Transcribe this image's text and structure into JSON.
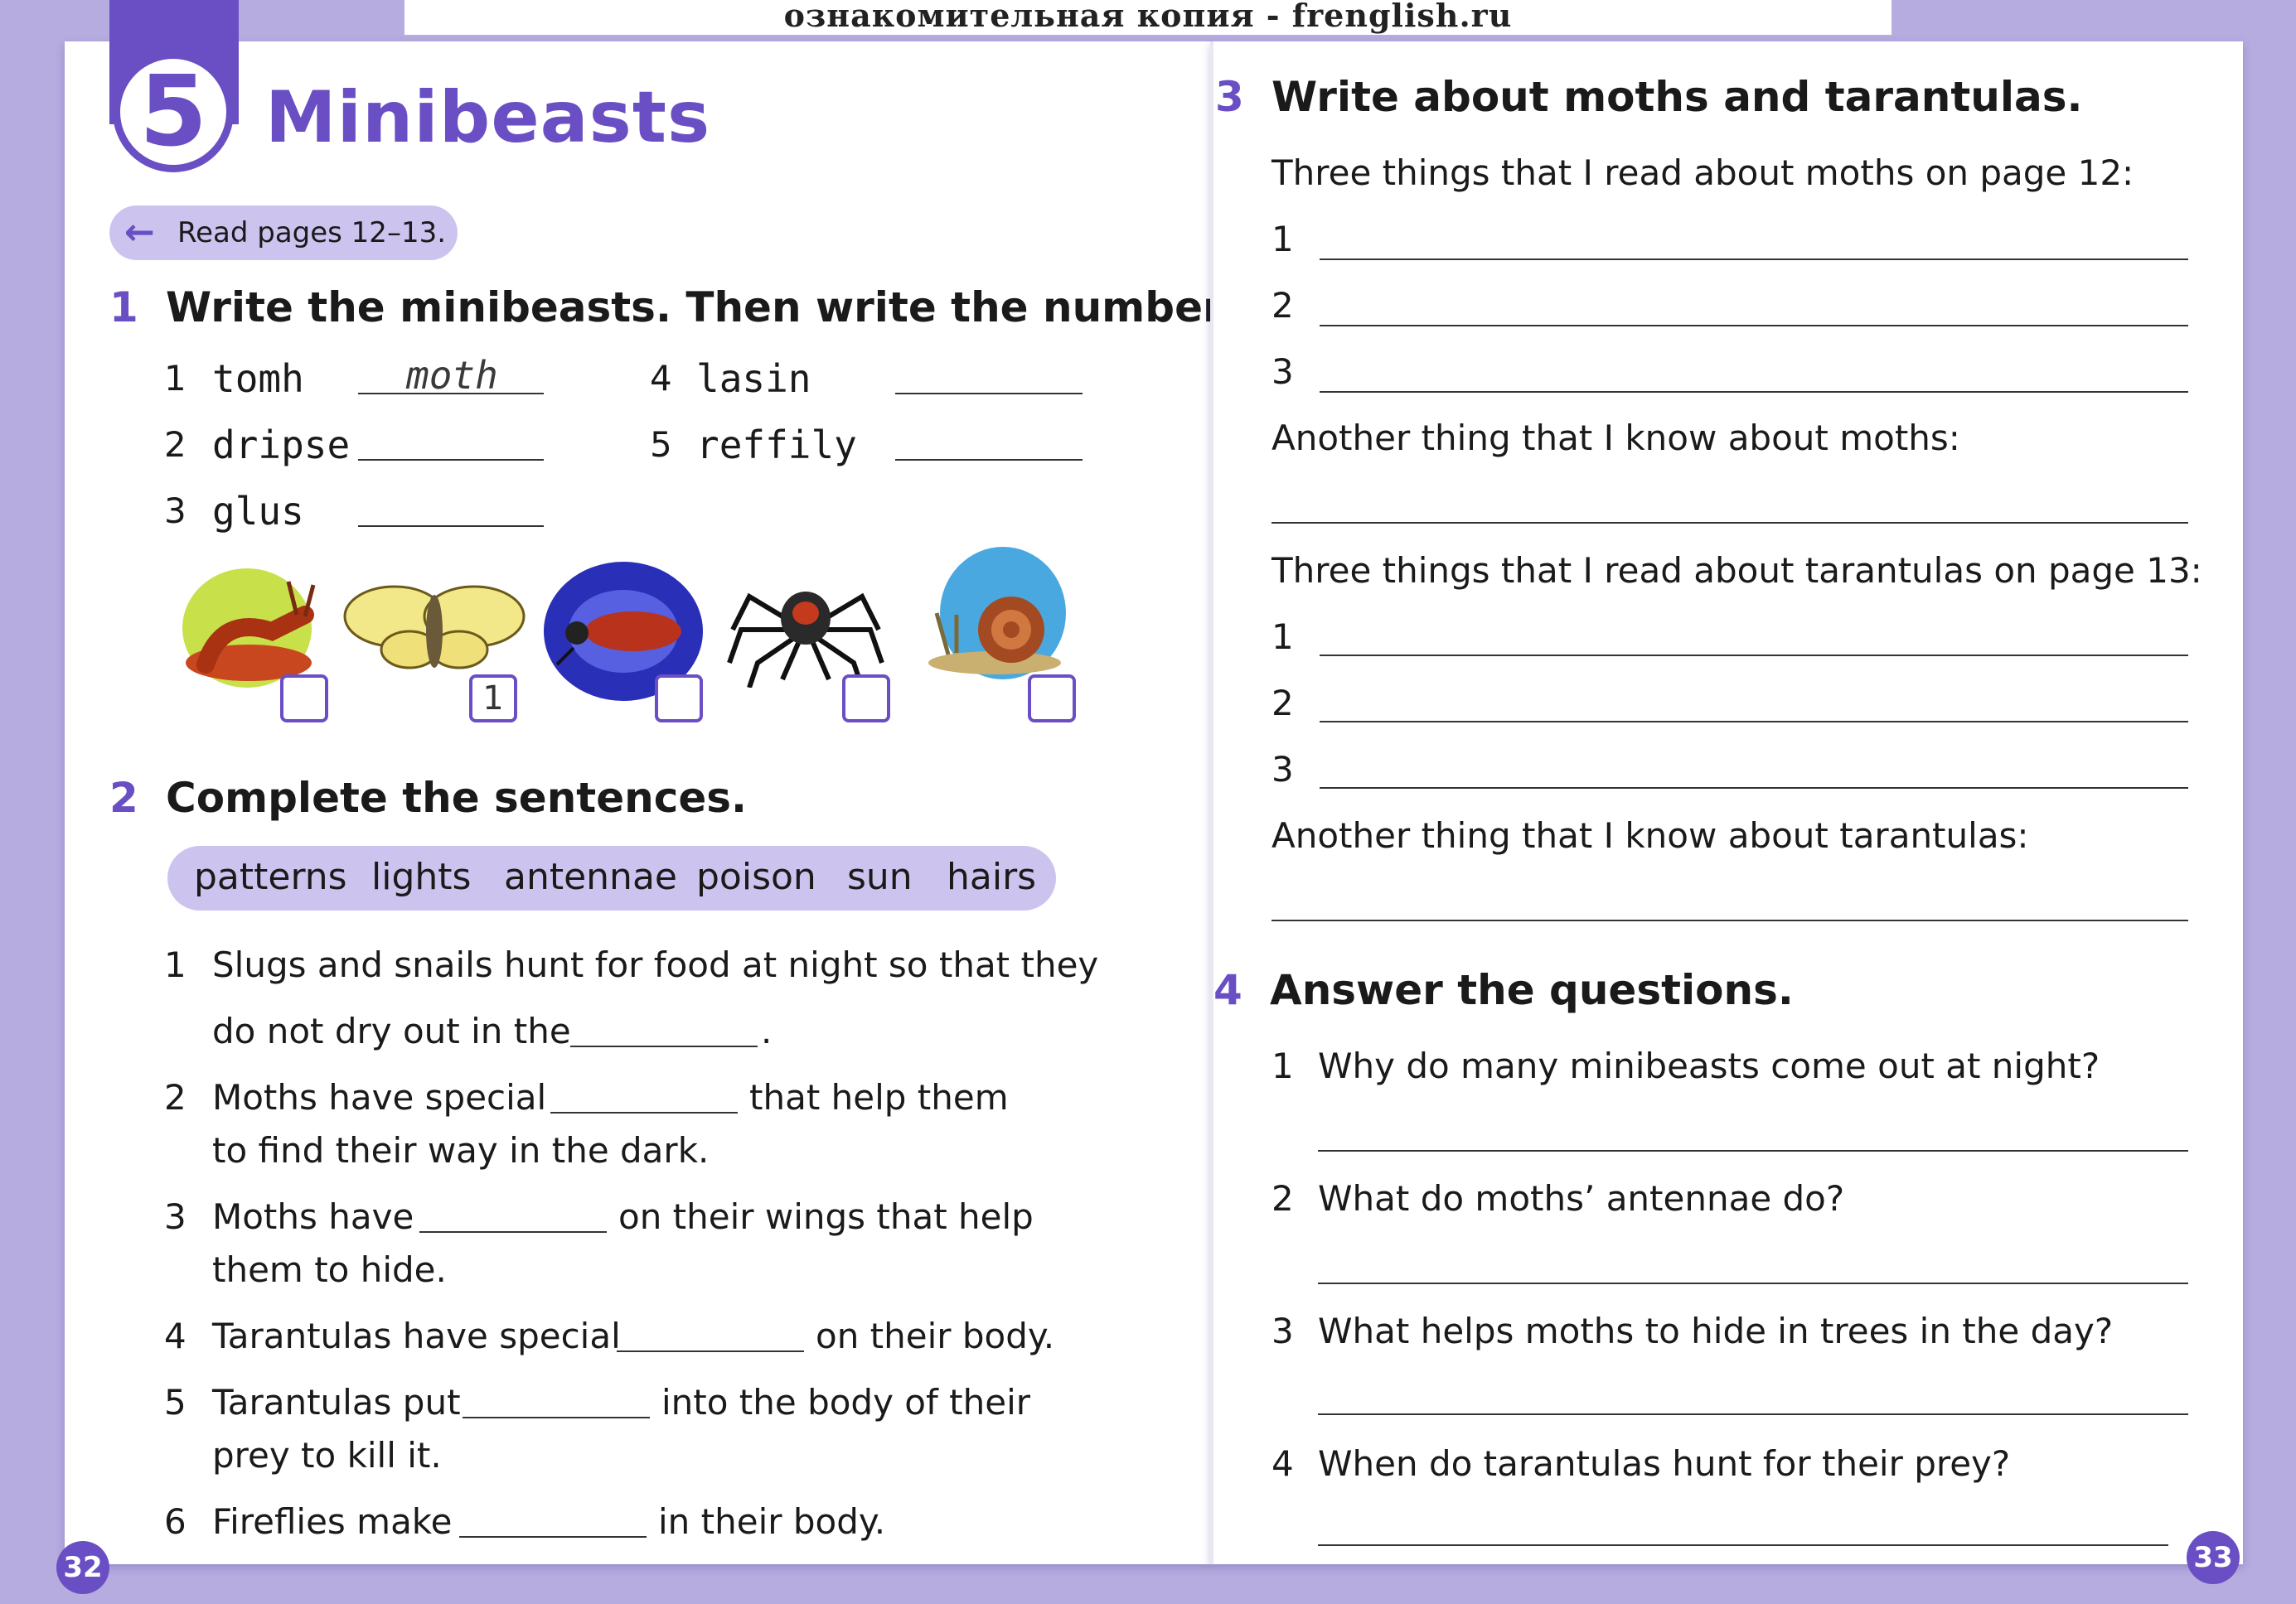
{
  "watermark": "ознакомительная копия - frenglish.ru",
  "unit": {
    "number": "5",
    "title": "Minibeasts"
  },
  "read_pages": "Read pages 12–13.",
  "ex1": {
    "number": "1",
    "title": "Write the minibeasts. Then write the numbers.",
    "items": [
      {
        "n": "1",
        "scrambled": "tomh",
        "answer": "moth"
      },
      {
        "n": "2",
        "scrambled": "dripse",
        "answer": ""
      },
      {
        "n": "3",
        "scrambled": "glus",
        "answer": ""
      },
      {
        "n": "4",
        "scrambled": "lasin",
        "answer": ""
      },
      {
        "n": "5",
        "scrambled": "reffily",
        "answer": ""
      }
    ],
    "pictures": [
      {
        "icon": "slug-icon",
        "box": ""
      },
      {
        "icon": "moth-icon",
        "box": "1"
      },
      {
        "icon": "firefly-icon",
        "box": ""
      },
      {
        "icon": "spider-icon",
        "box": ""
      },
      {
        "icon": "snail-icon",
        "box": ""
      }
    ]
  },
  "ex2": {
    "number": "2",
    "title": "Complete the sentences.",
    "word_bank": [
      "patterns",
      "lights",
      "antennae",
      "poison",
      "sun",
      "hairs"
    ],
    "sentences": [
      {
        "n": "1",
        "a": "Slugs and snails hunt for food at night so that they",
        "b": "do not dry out in the",
        "c": "."
      },
      {
        "n": "2",
        "a": "Moths have special",
        "b": "that help them",
        "c": "to find their way in the dark."
      },
      {
        "n": "3",
        "a": "Moths have",
        "b": "on their wings that help",
        "c": "them to hide."
      },
      {
        "n": "4",
        "a": "Tarantulas have special",
        "b": "on their body."
      },
      {
        "n": "5",
        "a": "Tarantulas put",
        "b": "into the body of their",
        "c": "prey to kill it."
      },
      {
        "n": "6",
        "a": "Fireflies make",
        "b": "in their body."
      }
    ]
  },
  "ex3": {
    "number": "3",
    "title": "Write about moths and tarantulas.",
    "moths_prompt": "Three things that I read about moths on page 12:",
    "moths_another": "Another thing that I know about moths:",
    "tarantulas_prompt": "Three things that I read about tarantulas on page 13:",
    "tarantulas_another": "Another thing that I know about tarantulas:",
    "line_numbers": [
      "1",
      "2",
      "3"
    ]
  },
  "ex4": {
    "number": "4",
    "title": "Answer the questions.",
    "questions": [
      {
        "n": "1",
        "q": "Why do many minibeasts come out at night?"
      },
      {
        "n": "2",
        "q": "What do moths’ antennae do?"
      },
      {
        "n": "3",
        "q": "What helps moths to hide in trees in the day?"
      },
      {
        "n": "4",
        "q": "When do tarantulas hunt for their prey?"
      }
    ]
  },
  "page_numbers": {
    "left": "32",
    "right": "33"
  },
  "colors": {
    "accent": "#6a4fc4",
    "pill": "#ccc4ee",
    "background": "#b7ace0"
  }
}
